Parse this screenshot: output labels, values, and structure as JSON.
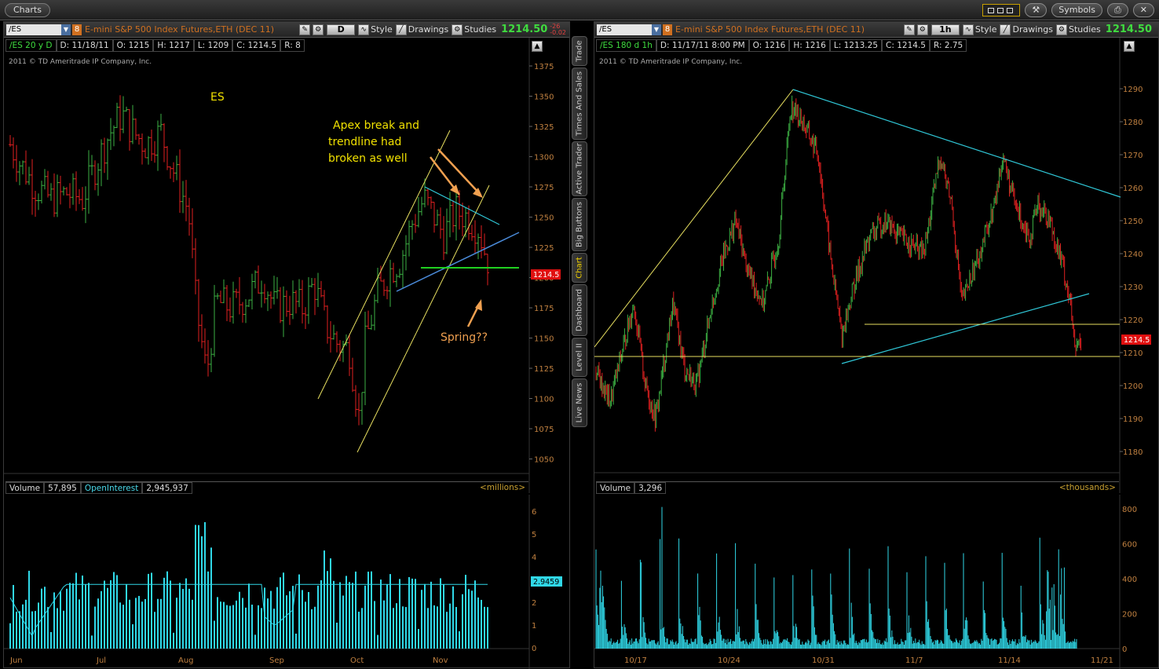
{
  "app": {
    "tab": "Charts",
    "symbols_button": "Symbols"
  },
  "left": {
    "symbol": "/ES",
    "link_number": "8",
    "title": "E-mini S&P 500 Index Futures,ETH (DEC 11)",
    "timeframe": "D",
    "style_label": "Style",
    "drawings_label": "Drawings",
    "studies_label": "Studies",
    "last": "1214.50",
    "change_top": "-26",
    "change_bottom": "-0.02",
    "info": [
      "/ES 20 y D",
      "D: 11/18/11",
      "O: 1215",
      "H: 1217",
      "L: 1209",
      "C: 1214.5",
      "R: 8"
    ],
    "copyright": "2011 © TD Ameritrade IP Company, Inc.",
    "price_ticks": [
      "1375",
      "1350",
      "1325",
      "1300",
      "1275",
      "1250",
      "1225",
      "1200",
      "1175",
      "1150",
      "1125",
      "1100",
      "1075",
      "1050"
    ],
    "price_tag": "1214.5",
    "annotations": {
      "es": "ES",
      "apex_1": "Apex break and",
      "apex_2": "trendline had",
      "apex_3": "broken as well",
      "spring": "Spring??"
    },
    "volume": {
      "label": "Volume",
      "value": "57,895",
      "oi_label": "OpenInterest",
      "oi_value": "2,945,937",
      "units": "<millions>",
      "ticks": [
        "6",
        "5",
        "4",
        "3",
        "2",
        "1",
        "0"
      ],
      "tag": "2.9459"
    },
    "months": [
      "Jun",
      "Jul",
      "Aug",
      "Sep",
      "Oct",
      "Nov"
    ]
  },
  "right": {
    "symbol": "/ES",
    "link_number": "8",
    "title": "E-mini S&P 500 Index Futures,ETH (DEC 11)",
    "timeframe": "1h",
    "style_label": "Style",
    "drawings_label": "Drawings",
    "studies_label": "Studies",
    "last": "1214.50",
    "info": [
      "/ES 180 d 1h",
      "D: 11/17/11 8:00 PM",
      "O: 1216",
      "H: 1216",
      "L: 1213.25",
      "C: 1214.5",
      "R: 2.75"
    ],
    "copyright": "2011 © TD Ameritrade IP Company, Inc.",
    "price_ticks": [
      "1290",
      "1280",
      "1270",
      "1260",
      "1250",
      "1240",
      "1230",
      "1220",
      "1210",
      "1200",
      "1190",
      "1180"
    ],
    "price_tag": "1214.5",
    "volume": {
      "label": "Volume",
      "value": "3,296",
      "units": "<thousands>",
      "ticks": [
        "800",
        "600",
        "400",
        "200",
        "0"
      ]
    },
    "dates": [
      "10/17",
      "10/24",
      "10/31",
      "11/7",
      "11/14",
      "11/21"
    ]
  },
  "side_tabs": [
    "Trade",
    "Times And Sales",
    "Active Trader",
    "Big Buttons",
    "Chart",
    "Dashboard",
    "Level II",
    "Live News"
  ],
  "colors": {
    "up": "#3cb043",
    "down": "#e02020",
    "yellow_line": "#e8e060",
    "cyan_line": "#30c8d8",
    "blue_line": "#4a8ad8",
    "green_line": "#20d020",
    "annotation_arrow": "#f0a050",
    "volume_bar": "#30d8e8"
  }
}
